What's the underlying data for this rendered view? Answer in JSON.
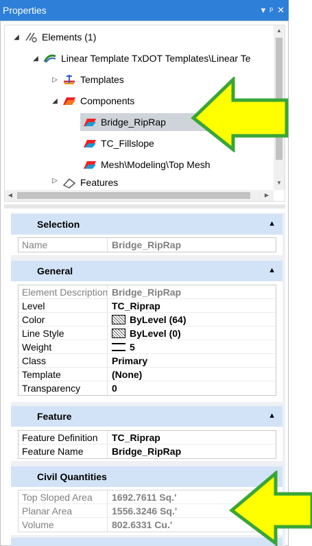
{
  "window": {
    "title": "Properties",
    "controls": [
      "▾",
      "ᵖ",
      "✕"
    ]
  },
  "tree": {
    "items": [
      {
        "label": "Elements (1)",
        "expander": "◢"
      },
      {
        "label": "Linear Template TxDOT Templates\\Linear Te",
        "expander": "◢"
      },
      {
        "label": "Templates",
        "expander": "▷"
      },
      {
        "label": "Components",
        "expander": "◢"
      },
      {
        "label": "Bridge_RipRap",
        "expander": ""
      },
      {
        "label": "TC_Fillslope",
        "expander": ""
      },
      {
        "label": "Mesh\\Modeling\\Top Mesh",
        "expander": ""
      },
      {
        "label": "Features",
        "expander": "▷"
      }
    ]
  },
  "sections": {
    "selection": {
      "title": "Selection",
      "rows": [
        {
          "name": "Name",
          "value": "Bridge_RipRap"
        }
      ]
    },
    "general": {
      "title": "General",
      "rows": [
        {
          "name": "Element Description",
          "value": "Bridge_RipRap"
        },
        {
          "name": "Level",
          "value": "TC_Riprap"
        },
        {
          "name": "Color",
          "value": "ByLevel (64)"
        },
        {
          "name": "Line Style",
          "value": "ByLevel (0)"
        },
        {
          "name": "Weight",
          "value": "5"
        },
        {
          "name": "Class",
          "value": "Primary"
        },
        {
          "name": "Template",
          "value": "(None)"
        },
        {
          "name": "Transparency",
          "value": "0"
        }
      ]
    },
    "feature": {
      "title": "Feature",
      "rows": [
        {
          "name": "Feature Definition",
          "value": "TC_Riprap"
        },
        {
          "name": "Feature Name",
          "value": "Bridge_RipRap"
        }
      ]
    },
    "civil": {
      "title": "Civil Quantities",
      "rows": [
        {
          "name": "Top Sloped Area",
          "value": "1692.7611 Sq.'"
        },
        {
          "name": "Planar Area",
          "value": "1556.3246 Sq.'"
        },
        {
          "name": "Volume",
          "value": "802.6331 Cu.'"
        }
      ]
    }
  },
  "colors": {
    "titlebar": "#2d7fd8",
    "section_header": "#d3e3f7",
    "selected_row": "#cfd4da",
    "callout_fill": "#ffff00",
    "callout_stroke": "#3aa537"
  }
}
